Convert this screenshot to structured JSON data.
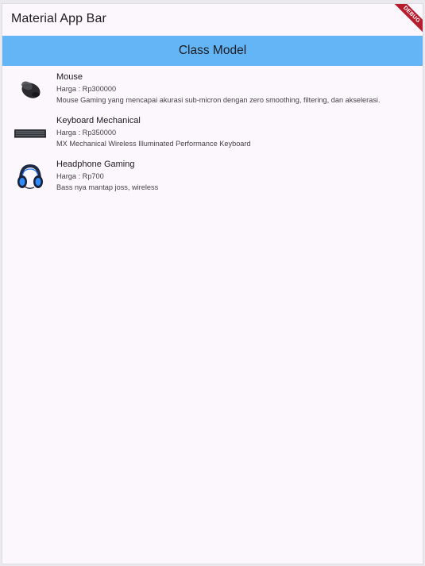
{
  "appbar": {
    "title": "Material App Bar",
    "debug_label": "DEBUG"
  },
  "section": {
    "title": "Class Model"
  },
  "products": [
    {
      "name": "Mouse",
      "price": "Harga : Rp300000",
      "description": "Mouse Gaming yang mencapai akurasi sub-micron dengan zero smoothing, filtering, dan akselerasi.",
      "icon": "mouse-image"
    },
    {
      "name": "Keyboard Mechanical",
      "price": "Harga : Rp350000",
      "description": "MX Mechanical Wireless Illuminated Performance Keyboard",
      "icon": "keyboard-image"
    },
    {
      "name": "Headphone Gaming",
      "price": "Harga : Rp700",
      "description": "Bass nya mantap joss, wireless",
      "icon": "headphone-image"
    }
  ],
  "colors": {
    "header_bg": "#64b5f6",
    "page_bg": "#fcf6fd",
    "debug_ribbon": "#b71c2c"
  }
}
